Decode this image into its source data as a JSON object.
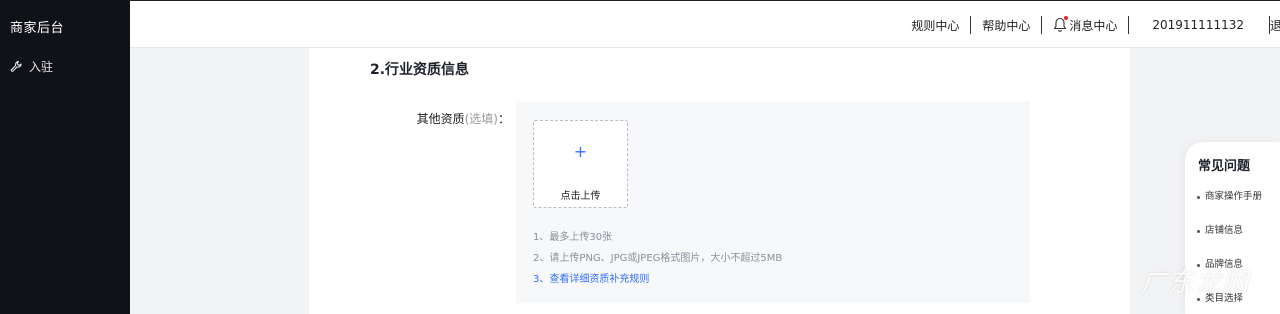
{
  "sidebar": {
    "brand": "商家后台",
    "items": [
      {
        "label": "入驻",
        "icon": "wrench-icon"
      }
    ]
  },
  "header": {
    "links": {
      "rules": "规则中心",
      "help": "帮助中心",
      "messages": "消息中心",
      "user": "201911111132",
      "logout": "退"
    },
    "bell_icon": "bell-icon",
    "notification_dot_color": "#f5222d"
  },
  "main": {
    "section_title": "2.行业资质信息",
    "field": {
      "label": "其他资质",
      "optional": "(选填)",
      "colon": "："
    },
    "upload": {
      "plus_icon": "+",
      "label": "点击上传"
    },
    "tips": [
      "1、最多上传30张",
      "2、请上传PNG、JPG或JPEG格式图片，大小不超过5MB"
    ],
    "tip_link": "3、查看详细资质补充规则"
  },
  "faq": {
    "title": "常见问题",
    "items": [
      "商家操作手册",
      "店铺信息",
      "品牌信息",
      "类目选择"
    ]
  },
  "watermark": "广东龙网",
  "colors": {
    "sidebar_bg": "#101218",
    "accent": "#3370ff",
    "page_bg": "#f2f3f5"
  }
}
